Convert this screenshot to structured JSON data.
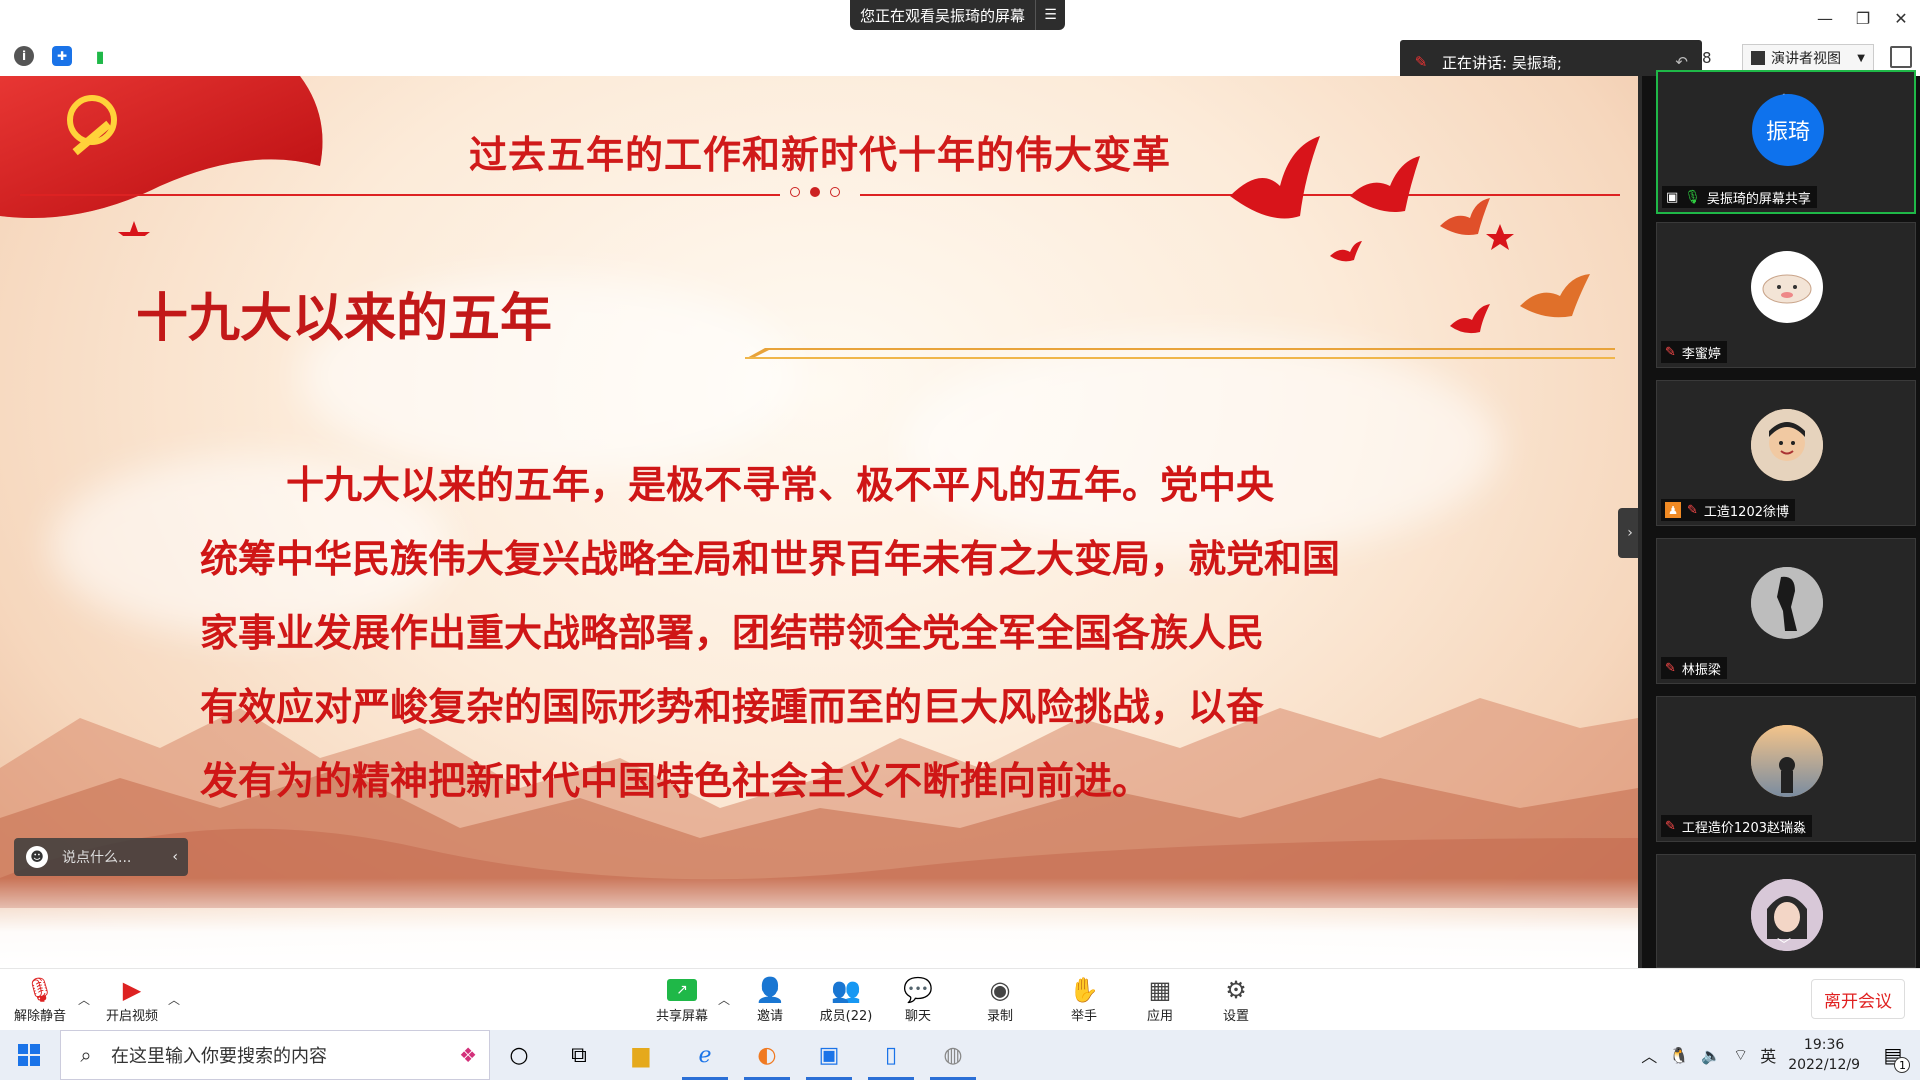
{
  "window": {
    "viewing_label": "您正在观看吴振琦的屏幕"
  },
  "speaker": {
    "label": "正在讲话: 吴振琦;"
  },
  "toolbar": {
    "participant_count": "8",
    "view_mode": "演讲者视图"
  },
  "slide": {
    "title": "过去五年的工作和新时代十年的伟大变革",
    "subtitle": "十九大以来的五年",
    "lines": [
      "十九大以来的五年，是极不寻常、极不平凡的五年。党中央",
      "统筹中华民族伟大复兴战略全局和世界百年未有之大变局，就党和国",
      "家事业发展作出重大战略部署，团结带领全党全军全国各族人民",
      "有效应对严峻复杂的国际形势和接踵而至的巨大风险挑战，以奋",
      "发有为的精神把新时代中国特色社会主义不断推向前进。"
    ],
    "chat_placeholder": "说点什么..."
  },
  "participants": [
    {
      "name": "吴振琦的屏幕共享",
      "avatar_text": "振琦",
      "avatar_color": "#0e72ed"
    },
    {
      "name": "李蜜婷",
      "avatar_text": "",
      "avatar_color": "#ffffff"
    },
    {
      "name": "工造1202徐博",
      "avatar_text": "",
      "avatar_color": "#d9b48f"
    },
    {
      "name": "林振梁",
      "avatar_text": "",
      "avatar_color": "#8a8a8a"
    },
    {
      "name": "工程造价1203赵瑞淼",
      "avatar_text": "",
      "avatar_color": "#e6a15a"
    },
    {
      "name": "",
      "avatar_text": "",
      "avatar_color": "#c9b7c9"
    }
  ],
  "meeting_bar": {
    "unmute": "解除静音",
    "start_video": "开启视频",
    "share_screen": "共享屏幕",
    "invite": "邀请",
    "members": "成员(22)",
    "chat": "聊天",
    "record": "录制",
    "raise_hand": "举手",
    "apps": "应用",
    "settings": "设置",
    "leave": "离开会议"
  },
  "taskbar": {
    "search_placeholder": "在这里输入你要搜索的内容",
    "ime": "英",
    "time": "19:36",
    "date": "2022/12/9",
    "notif_count": "1"
  },
  "colors": {
    "slide_red": "#cf1616",
    "zoom_blue": "#0e72ed",
    "active_green": "#1fb848",
    "leave_red": "#e02020"
  }
}
